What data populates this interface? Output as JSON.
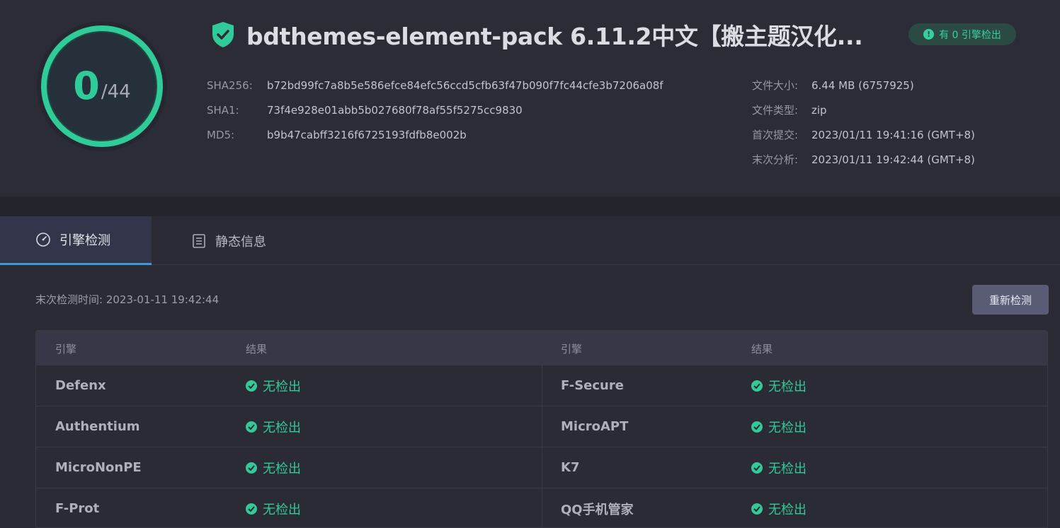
{
  "score": {
    "detected": "0",
    "total": "/44",
    "ratio": 0
  },
  "header": {
    "title": "bdthemes-element-pack 6.11.2中文【搬主题汉化...",
    "badge": "有 0 引擎检出"
  },
  "hashes": [
    {
      "label": "SHA256:",
      "value": "b72bd99fc7a8b5e586efce84efc56ccd5cfb63f47b090f7fc44cfe3b7206a08f"
    },
    {
      "label": "SHA1:",
      "value": "73f4e928e01abb5b027680f78af55f5275cc9830"
    },
    {
      "label": "MD5:",
      "value": "b9b47cabff3216f6725193fdfb8e002b"
    }
  ],
  "meta": [
    {
      "label": "文件大小:",
      "value": "6.44 MB (6757925)"
    },
    {
      "label": "文件类型:",
      "value": "zip"
    },
    {
      "label": "首次提交:",
      "value": "2023/01/11 19:41:16 (GMT+8)"
    },
    {
      "label": "末次分析:",
      "value": "2023/01/11 19:42:44 (GMT+8)"
    }
  ],
  "tabs": [
    {
      "label": "引擎检测",
      "icon": "gauge-icon"
    },
    {
      "label": "静态信息",
      "icon": "list-icon"
    }
  ],
  "last_check": "末次检测时间: 2023-01-11 19:42:44",
  "recheck_label": "重新检测",
  "table": {
    "headers": [
      "引擎",
      "结果",
      "引擎",
      "结果"
    ],
    "rows": [
      {
        "left_engine": "Defenx",
        "left_result": "无检出",
        "right_engine": "F-Secure",
        "right_result": "无检出"
      },
      {
        "left_engine": "Authentium",
        "left_result": "无检出",
        "right_engine": "MicroAPT",
        "right_result": "无检出"
      },
      {
        "left_engine": "MicroNonPE",
        "left_result": "无检出",
        "right_engine": "K7",
        "right_result": "无检出"
      },
      {
        "left_engine": "F-Prot",
        "left_result": "无检出",
        "right_engine": "QQ手机管家",
        "right_result": "无检出"
      }
    ]
  },
  "colors": {
    "accent": "#2fcb98",
    "tab_underline": "#3c9bd6"
  }
}
